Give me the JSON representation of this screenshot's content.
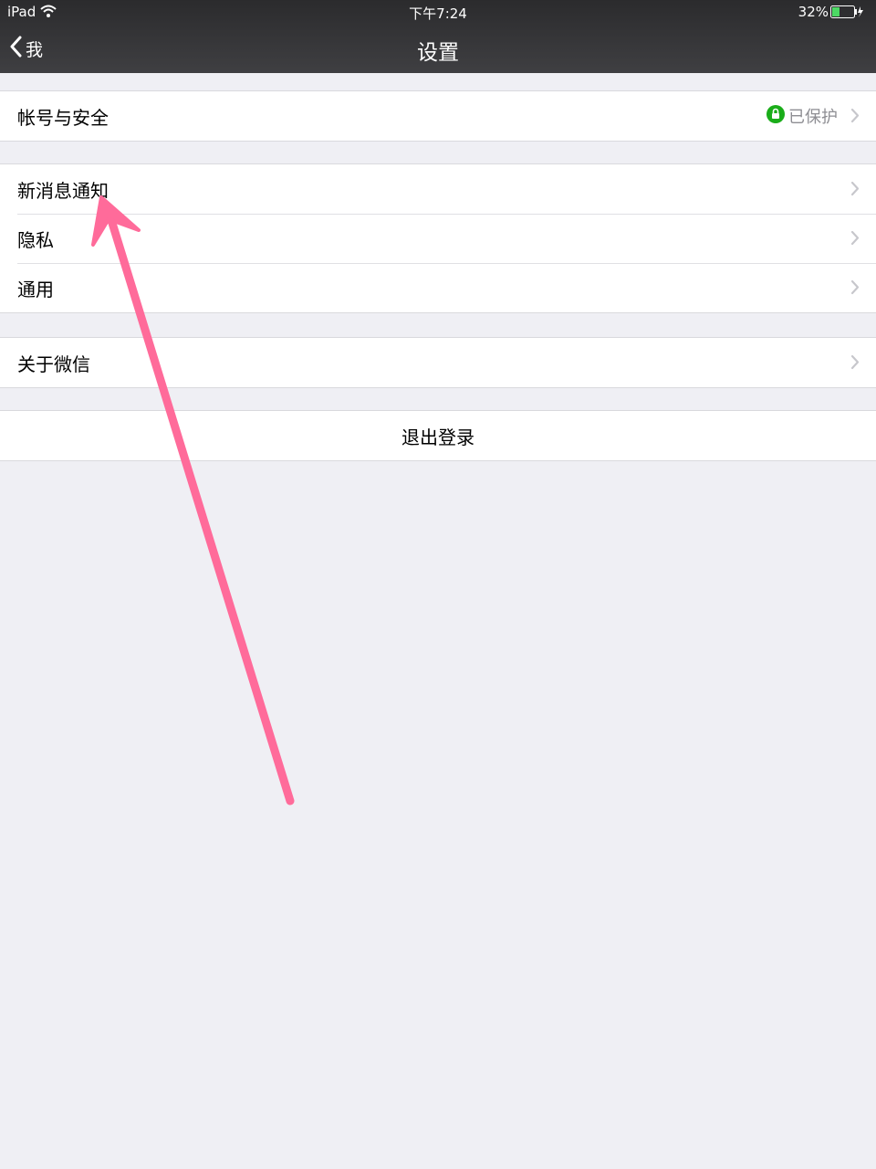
{
  "status_bar": {
    "device": "iPad",
    "time": "下午7:24",
    "battery": "32%"
  },
  "nav": {
    "back_label": "我",
    "title": "设置"
  },
  "groups": {
    "account": {
      "title": "帐号与安全",
      "status": "已保护"
    },
    "settings": [
      {
        "title": "新消息通知"
      },
      {
        "title": "隐私"
      },
      {
        "title": "通用"
      }
    ],
    "about": {
      "title": "关于微信"
    },
    "logout": {
      "label": "退出登录"
    }
  },
  "colors": {
    "accent_green": "#1aad19",
    "annotation_arrow": "#ff6b9a",
    "background": "#efeff4"
  }
}
